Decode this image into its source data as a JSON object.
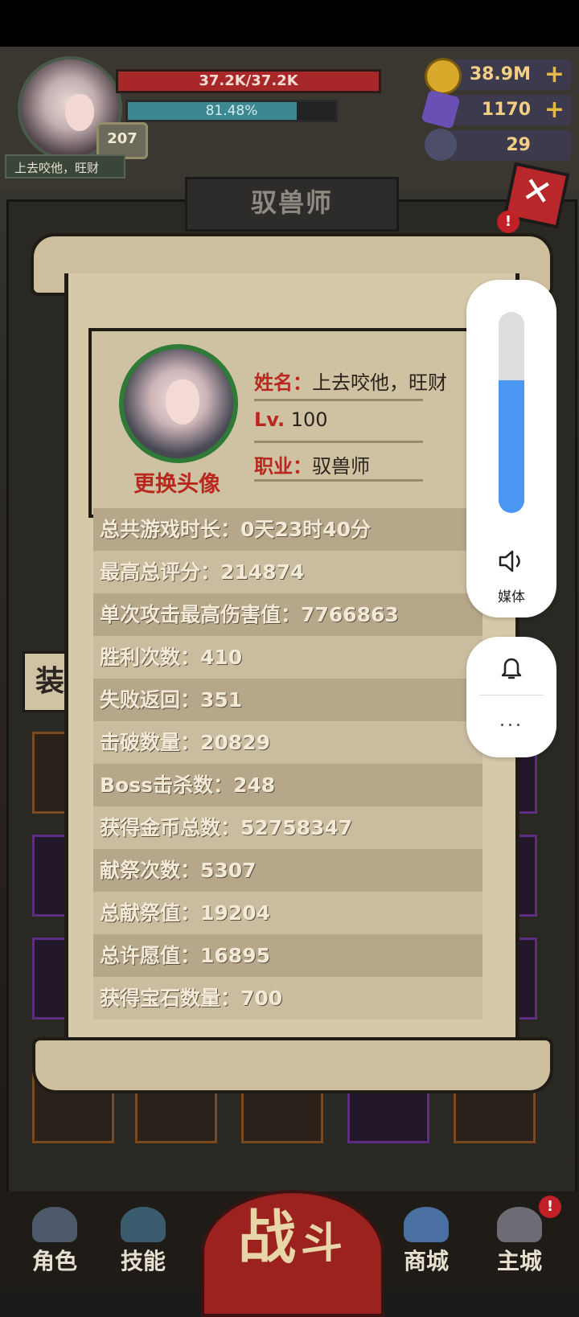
{
  "hud": {
    "hp_text": "37.2K/37.2K",
    "xp_text": "81.48%",
    "xp_progress": 0.8148,
    "level": "207",
    "player_name": "上去咬他，旺财",
    "gold": "38.9M",
    "gems": "1170",
    "souls": "29"
  },
  "panel": {
    "title": "驭兽师",
    "equip_tab": "装"
  },
  "profile": {
    "name_key": "姓名：",
    "name_value": "上去咬他，旺财",
    "level_key": "Lv.",
    "level_value": "100",
    "class_key": "职业：",
    "class_value": "驭兽师",
    "change_avatar": "更换头像"
  },
  "stats": [
    "总共游戏时长：0天23时40分",
    "最高总评分：214874",
    "单次攻击最高伤害值：7766863",
    "胜利次数：410",
    "失败返回：351",
    "击破数量：20829",
    "Boss击杀数：248",
    "获得金币总数：52758347",
    "献祭次数：5307",
    "总献祭值：19204",
    "总许愿值：16895",
    "获得宝石数量：700"
  ],
  "nav": {
    "role": "角色",
    "skill": "技能",
    "fight_1": "战",
    "fight_2": "斗",
    "shop": "商城",
    "city": "主城"
  },
  "volume_overlay": {
    "level": 0.66,
    "label": "媒体",
    "more": "..."
  },
  "colors": {
    "hp": "#a8282a",
    "xp": "#3c8790",
    "accent_red": "#b9281f",
    "volume_blue": "#4b97f4"
  }
}
